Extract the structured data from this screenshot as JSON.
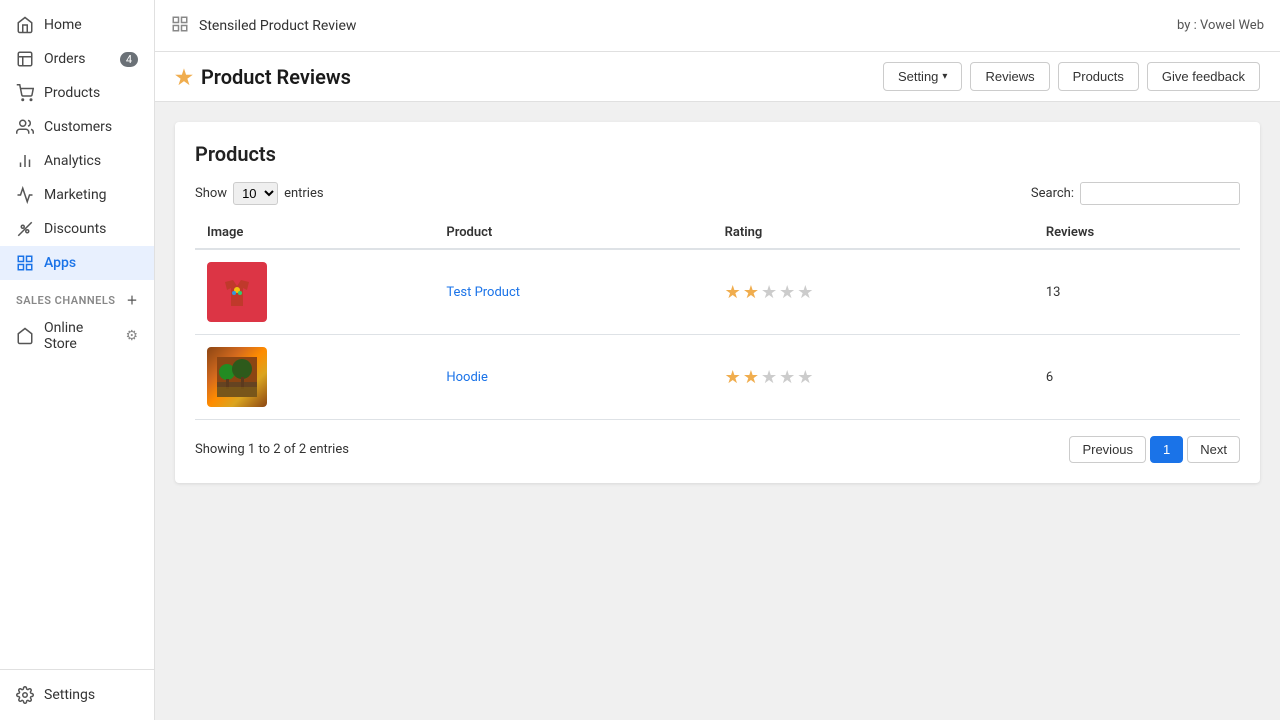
{
  "sidebar": {
    "items": [
      {
        "label": "Home",
        "icon": "home-icon",
        "active": false
      },
      {
        "label": "Orders",
        "icon": "orders-icon",
        "active": false,
        "badge": "4"
      },
      {
        "label": "Products",
        "icon": "products-icon",
        "active": false
      },
      {
        "label": "Customers",
        "icon": "customers-icon",
        "active": false
      },
      {
        "label": "Analytics",
        "icon": "analytics-icon",
        "active": false
      },
      {
        "label": "Marketing",
        "icon": "marketing-icon",
        "active": false
      },
      {
        "label": "Discounts",
        "icon": "discounts-icon",
        "active": false
      },
      {
        "label": "Apps",
        "icon": "apps-icon",
        "active": true
      }
    ],
    "sales_channels_label": "SALES CHANNELS",
    "sales_channels": [
      {
        "label": "Online Store",
        "icon": "store-icon"
      }
    ],
    "settings_label": "Settings"
  },
  "topbar": {
    "icon": "grid-icon",
    "title": "Stensiled Product Review",
    "by_label": "by : Vowel Web"
  },
  "header": {
    "star_icon": "★",
    "title": "Product Reviews",
    "buttons": {
      "setting": "Setting",
      "reviews": "Reviews",
      "products": "Products",
      "give_feedback": "Give feedback"
    }
  },
  "products_panel": {
    "title": "Products",
    "show_label": "Show",
    "entries_label": "entries",
    "show_value": "10",
    "search_label": "Search:",
    "search_placeholder": "",
    "columns": [
      "Image",
      "Product",
      "Rating",
      "Reviews"
    ],
    "rows": [
      {
        "product_name": "Test Product",
        "rating": 2,
        "max_rating": 5,
        "reviews_count": "13"
      },
      {
        "product_name": "Hoodie",
        "rating": 2,
        "max_rating": 5,
        "reviews_count": "6"
      }
    ],
    "showing_text": "Showing 1 to 2 of 2 entries",
    "pagination": {
      "previous": "Previous",
      "current_page": "1",
      "next": "Next"
    }
  }
}
